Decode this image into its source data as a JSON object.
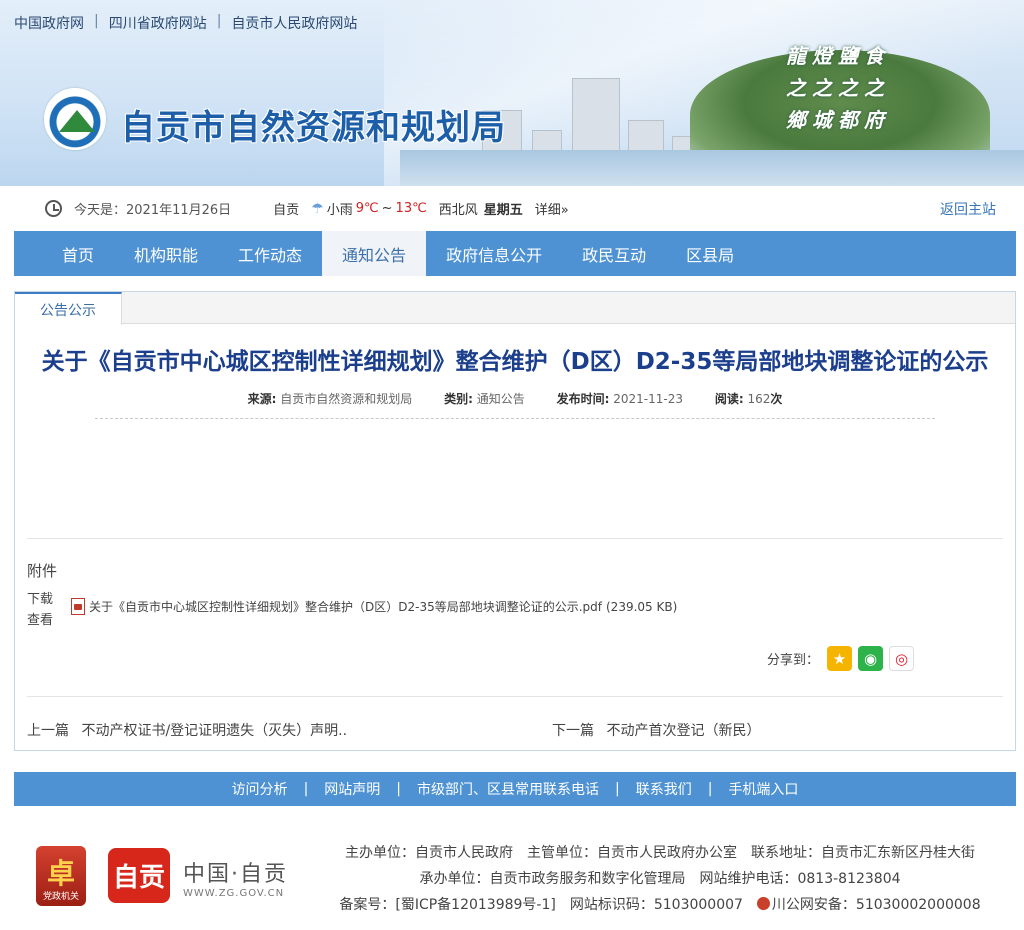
{
  "toplinks": [
    "中国政府网",
    "四川省政府网站",
    "自贡市人民政府网站"
  ],
  "toplinks_sep": "|",
  "site_title": "自贡市自然资源和规划局",
  "calligraphy": "龍燈鹽食 之之之之 鄉城都府",
  "infobar": {
    "today": "今天是：2021年11月26日",
    "city": "自贡",
    "weather": "小雨",
    "temp_low": "9℃",
    "temp_sep": "~",
    "temp_high": "13℃",
    "wind": "西北风",
    "weekday": "星期五",
    "detail": "详细»",
    "home_link": "返回主站"
  },
  "nav": [
    "首页",
    "机构职能",
    "工作动态",
    "通知公告",
    "政府信息公开",
    "政民互动",
    "区县局"
  ],
  "nav_active": "通知公告",
  "tab_label": "公告公示",
  "article": {
    "title": "关于《自贡市中心城区控制性详细规划》整合维护（D区）D2-35等局部地块调整论证的公示",
    "source_label": "来源:",
    "source": "自贡市自然资源和规划局",
    "category_label": "类别:",
    "category": "通知公告",
    "date_label": "发布时间:",
    "date": "2021-11-23",
    "reads_label": "阅读:",
    "reads": "162",
    "reads_unit": "次"
  },
  "attachment": {
    "heading": "附件",
    "label": "下载查看",
    "filename": "关于《自贡市中心城区控制性详细规划》整合维护（D区）D2-35等局部地块调整论证的公示.pdf",
    "size": "(239.05 KB)"
  },
  "share": {
    "label": "分享到：",
    "icons": [
      "qzone-icon",
      "wechat-icon",
      "weibo-icon"
    ]
  },
  "prevnext": {
    "prev_label": "上一篇",
    "prev_title": "不动产权证书/登记证明遗失（灭失）声明..",
    "next_label": "下一篇",
    "next_title": "不动产首次登记（新民）"
  },
  "footer_nav": [
    "访问分析",
    "网站声明",
    "市级部门、区县常用联系电话",
    "联系我们",
    "手机端入口"
  ],
  "footer": {
    "badge1_text": "党政机关",
    "badge2_text": "自贡",
    "zg_cn": "中国·自贡",
    "zg_en": "WWW.ZG.GOV.CN",
    "line1": "主办单位：自贡市人民政府　主管单位：自贡市人民政府办公室　联系地址：自贡市汇东新区丹桂大街",
    "line2": "承办单位：自贡市政务服务和数字化管理局　网站维护电话：0813-8123804",
    "line3_a": "备案号：[蜀ICP备12013989号-1]　网站标识码：5103000007　",
    "line3_b": "川公网安备：51030002000008"
  },
  "colors": {
    "nav": "#4e92d3",
    "title": "#1b3f8c",
    "temp": "#d02020"
  }
}
